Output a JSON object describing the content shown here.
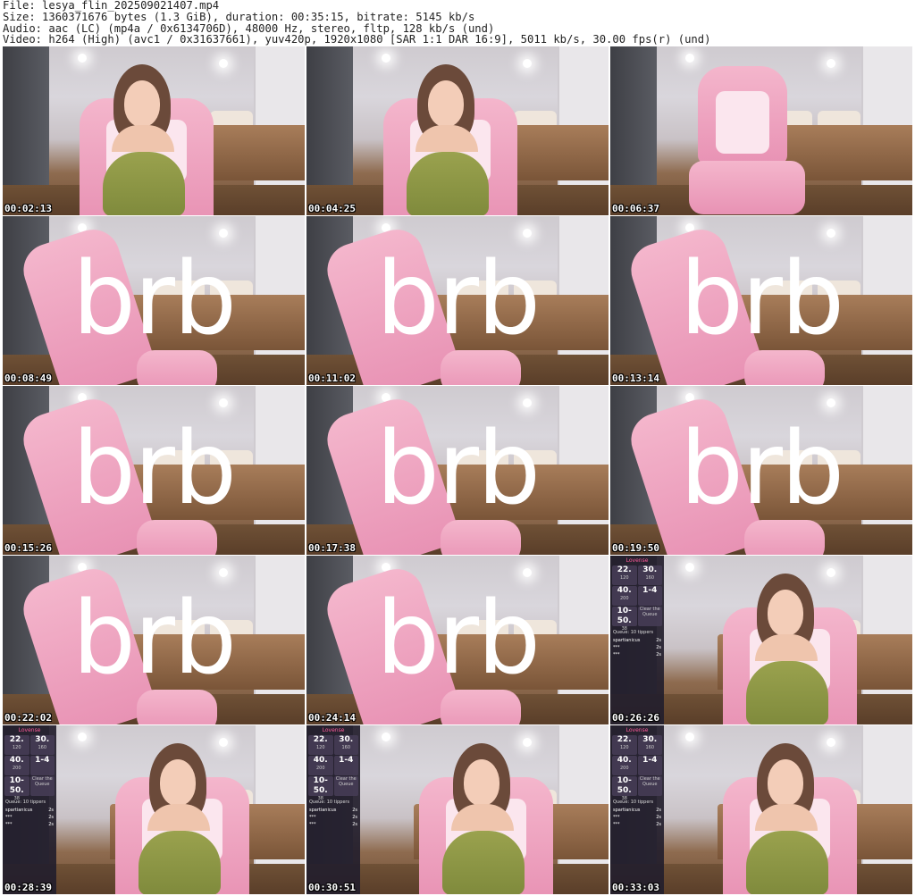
{
  "header": {
    "file": "File: lesya_flin_202509021407.mp4",
    "size": "Size: 1360371676 bytes (1.3 GiB), duration: 00:35:15, bitrate: 5145 kb/s",
    "audio": "Audio: aac (LC) (mp4a / 0x6134706D), 48000 Hz, stereo, fltp, 128 kb/s (und)",
    "video": "Video: h264 (High) (avc1 / 0x31637661), yuv420p, 1920x1080 [SAR 1:1 DAR 16:9], 5011 kb/s, 30.00 fps(r) (und)"
  },
  "thumbnails": [
    {
      "time": "00:02:13",
      "scene": "person"
    },
    {
      "time": "00:04:25",
      "scene": "person"
    },
    {
      "time": "00:06:37",
      "scene": "chair"
    },
    {
      "time": "00:08:49",
      "scene": "brb"
    },
    {
      "time": "00:11:02",
      "scene": "brb"
    },
    {
      "time": "00:13:14",
      "scene": "brb"
    },
    {
      "time": "00:15:26",
      "scene": "brb"
    },
    {
      "time": "00:17:38",
      "scene": "brb"
    },
    {
      "time": "00:19:50",
      "scene": "brb"
    },
    {
      "time": "00:22:02",
      "scene": "brb"
    },
    {
      "time": "00:24:14",
      "scene": "brb"
    },
    {
      "time": "00:26:26",
      "scene": "person-panel"
    },
    {
      "time": "00:28:39",
      "scene": "person-panel"
    },
    {
      "time": "00:30:51",
      "scene": "person-panel"
    },
    {
      "time": "00:33:03",
      "scene": "person-panel"
    }
  ],
  "brb_text": "brb",
  "panel": {
    "title": "Lovense",
    "cells": [
      {
        "value": "22.",
        "sub": "120"
      },
      {
        "value": "30.",
        "sub": "160"
      },
      {
        "value": "40.",
        "sub": "200"
      },
      {
        "value": "1-4",
        "sub": ""
      },
      {
        "value": "10-50.",
        "sub": "38"
      },
      {
        "value": "",
        "sub": "Clear the Queue"
      }
    ],
    "queue_label": "Queue: 10 tippers",
    "rows": [
      {
        "name": "spartianicus",
        "val": "2s"
      },
      {
        "name": "***",
        "val": "2s"
      },
      {
        "name": "***",
        "val": "2s"
      }
    ]
  }
}
